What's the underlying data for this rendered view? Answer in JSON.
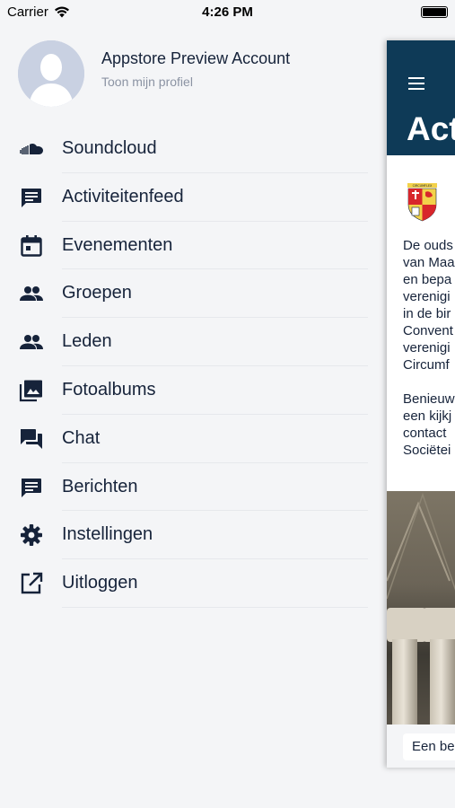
{
  "status_bar": {
    "carrier": "Carrier",
    "time": "4:26 PM",
    "battery_level": 1.0
  },
  "drawer": {
    "profile": {
      "name": "Appstore Preview Account",
      "subtitle": "Toon mijn profiel"
    },
    "menu": [
      {
        "label": "Soundcloud",
        "icon": "soundcloud-icon"
      },
      {
        "label": "Activiteitenfeed",
        "icon": "feed-icon"
      },
      {
        "label": "Evenementen",
        "icon": "calendar-icon"
      },
      {
        "label": "Groepen",
        "icon": "group-icon"
      },
      {
        "label": "Leden",
        "icon": "members-icon"
      },
      {
        "label": "Fotoalbums",
        "icon": "photo-album-icon"
      },
      {
        "label": "Chat",
        "icon": "chat-icon"
      },
      {
        "label": "Berichten",
        "icon": "message-icon"
      },
      {
        "label": "Instellingen",
        "icon": "settings-icon"
      },
      {
        "label": "Uitloggen",
        "icon": "logout-icon"
      }
    ]
  },
  "main_panel": {
    "title": "Acti",
    "crest_label": "CIRCUMFLEX",
    "body_lines": [
      "De ouds",
      "van Maa",
      "en bepa",
      "verenigi",
      "in de bir",
      "Convent",
      "verenigi",
      "Circumf",
      "",
      "Benieuw",
      "een kijkj",
      "contact",
      "Sociëtei"
    ],
    "footer_button": "Een be"
  },
  "colors": {
    "background": "#f4f5f7",
    "text": "#16233a",
    "header": "#0e3a57",
    "subtle_text": "#8b93a3"
  }
}
